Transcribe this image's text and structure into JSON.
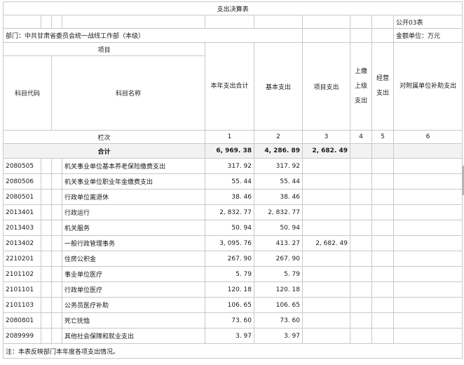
{
  "title": "支出决算表",
  "form_code": "公开03表",
  "department_label": "部门：中共甘肃省委员会统一战线工作部（本级）",
  "unit_label": "金额单位：万元",
  "header": {
    "project": "项目",
    "code": "科目代码",
    "name": "科目名称",
    "total": "本年支出合计",
    "basic": "基本支出",
    "project_exp": "项目支出",
    "upper": "上缴上级支出",
    "business": "经营支出",
    "subsidy": "对附属单位补助支出",
    "column_index": "栏次",
    "idx": [
      "1",
      "2",
      "3",
      "4",
      "5",
      "6"
    ]
  },
  "totals": {
    "label": "合计",
    "total": "6, 969. 38",
    "basic": "4, 286. 89",
    "project": "2, 682. 49"
  },
  "rows": [
    {
      "code": "2080505",
      "name": "机关事业单位基本养老保险缴费支出",
      "total": "317. 92",
      "basic": "317. 92",
      "project": ""
    },
    {
      "code": "2080506",
      "name": "机关事业单位职业年金缴费支出",
      "total": "55. 44",
      "basic": "55. 44",
      "project": ""
    },
    {
      "code": "2080501",
      "name": "行政单位离退休",
      "total": "38. 46",
      "basic": "38. 46",
      "project": ""
    },
    {
      "code": "2013401",
      "name": "行政运行",
      "total": "2, 832. 77",
      "basic": "2, 832. 77",
      "project": ""
    },
    {
      "code": "2013403",
      "name": "机关服务",
      "total": "50. 94",
      "basic": "50. 94",
      "project": ""
    },
    {
      "code": "2013402",
      "name": "一般行政管理事务",
      "total": "3, 095. 76",
      "basic": "413. 27",
      "project": "2, 682. 49"
    },
    {
      "code": "2210201",
      "name": "住房公积金",
      "total": "267. 90",
      "basic": "267. 90",
      "project": ""
    },
    {
      "code": "2101102",
      "name": "事业单位医疗",
      "total": "5. 79",
      "basic": "5. 79",
      "project": ""
    },
    {
      "code": "2101101",
      "name": "行政单位医疗",
      "total": "120. 18",
      "basic": "120. 18",
      "project": ""
    },
    {
      "code": "2101103",
      "name": "公务员医疗补助",
      "total": "106. 65",
      "basic": "106. 65",
      "project": ""
    },
    {
      "code": "2080801",
      "name": "死亡抚恤",
      "total": "73. 60",
      "basic": "73. 60",
      "project": ""
    },
    {
      "code": "2089999",
      "name": "其他社会保障和就业支出",
      "total": "3. 97",
      "basic": "3. 97",
      "project": ""
    }
  ],
  "note": "注：本表反映部门本年度各项支出情况。"
}
